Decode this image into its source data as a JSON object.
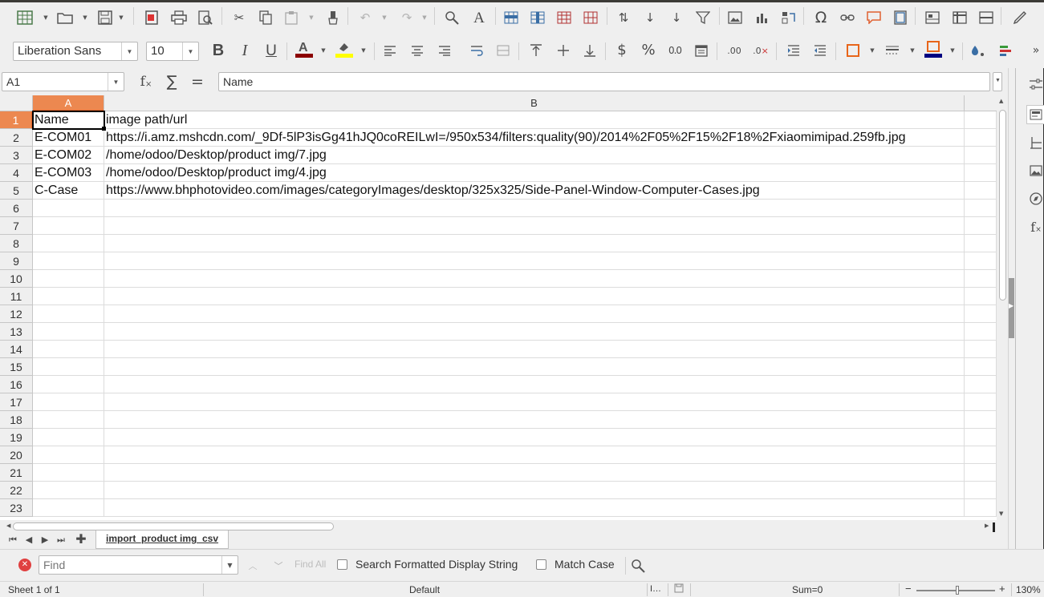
{
  "font_box": {
    "value": "Liberation Sans"
  },
  "size_box": {
    "value": "10"
  },
  "name_box": {
    "value": "A1"
  },
  "formula": {
    "value": "Name",
    "fx_label": "f",
    "sum_label": "∑",
    "eq_label": "="
  },
  "columns": [
    {
      "label": "A",
      "selected": true
    },
    {
      "label": "B",
      "selected": false
    }
  ],
  "rows": [
    {
      "n": "1",
      "a": "Name",
      "b": "image path/url"
    },
    {
      "n": "2",
      "a": "E-COM01",
      "b": "https://i.amz.mshcdn.com/_9Df-5lP3isGg41hJQ0coREILwI=/950x534/filters:quality(90)/2014%2F05%2F15%2F18%2Fxiaomimipad.259fb.jpg"
    },
    {
      "n": "3",
      "a": "E-COM02",
      "b": "/home/odoo/Desktop/product img/7.jpg"
    },
    {
      "n": "4",
      "a": "E-COM03",
      "b": "/home/odoo/Desktop/product img/4.jpg"
    },
    {
      "n": "5",
      "a": "C-Case",
      "b": "https://www.bhphotovideo.com/images/categoryImages/desktop/325x325/Side-Panel-Window-Computer-Cases.jpg"
    },
    {
      "n": "6",
      "a": "",
      "b": ""
    },
    {
      "n": "7",
      "a": "",
      "b": ""
    },
    {
      "n": "8",
      "a": "",
      "b": ""
    },
    {
      "n": "9",
      "a": "",
      "b": ""
    },
    {
      "n": "10",
      "a": "",
      "b": ""
    },
    {
      "n": "11",
      "a": "",
      "b": ""
    },
    {
      "n": "12",
      "a": "",
      "b": ""
    },
    {
      "n": "13",
      "a": "",
      "b": ""
    },
    {
      "n": "14",
      "a": "",
      "b": ""
    },
    {
      "n": "15",
      "a": "",
      "b": ""
    },
    {
      "n": "16",
      "a": "",
      "b": ""
    },
    {
      "n": "17",
      "a": "",
      "b": ""
    },
    {
      "n": "18",
      "a": "",
      "b": ""
    },
    {
      "n": "19",
      "a": "",
      "b": ""
    },
    {
      "n": "20",
      "a": "",
      "b": ""
    },
    {
      "n": "21",
      "a": "",
      "b": ""
    },
    {
      "n": "22",
      "a": "",
      "b": ""
    },
    {
      "n": "23",
      "a": "",
      "b": ""
    }
  ],
  "sheet_tab": {
    "label": "import_product img_csv"
  },
  "find_bar": {
    "placeholder": "Find",
    "find_all_label": "Find All",
    "formatted_label": "Search Formatted Display String",
    "match_case_label": "Match Case"
  },
  "status": {
    "sheet": "Sheet 1 of 1",
    "style": "Default",
    "sum": "Sum=0",
    "zoom": "130%",
    "zoom_minus": "−",
    "zoom_plus": "+"
  },
  "colors": {
    "selected_header": "#ec8850",
    "font_color_bar": "#8b0000",
    "highlight_bar": "#ffff00",
    "border_color": "#e8651a",
    "border_color_bar": "#000080"
  }
}
